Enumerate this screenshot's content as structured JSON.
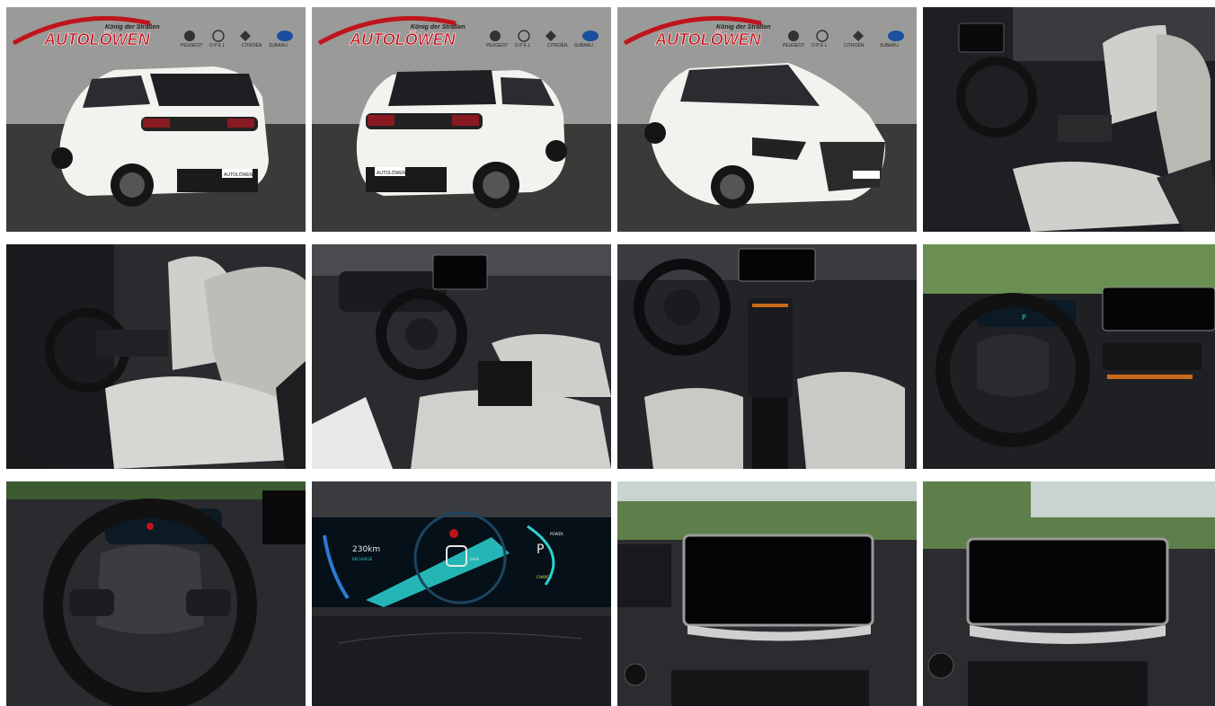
{
  "dealer": {
    "slogan": "König der Straßen",
    "name": "AUTOLÖWEN",
    "brands": [
      "PEUGEOT",
      "O P E L",
      "CITROËN",
      "SUBARU"
    ]
  },
  "plate": "AUTOLÖWEN",
  "cluster": {
    "range": "230km",
    "range_label": "RECHARGE",
    "speed_unit": "km/h",
    "gear": "P",
    "mode_top": "POWER",
    "mode_bottom": "CHARGE"
  },
  "colors": {
    "car_white": "#f2f2ef",
    "showroom_wall": "#9a9a98",
    "floor": "#3a3a38",
    "interior_dark": "#1e1f22",
    "seat_fabric": "#cfcfcb",
    "cluster_cyan": "#2ad4d0",
    "brand_red": "#c0141c"
  }
}
